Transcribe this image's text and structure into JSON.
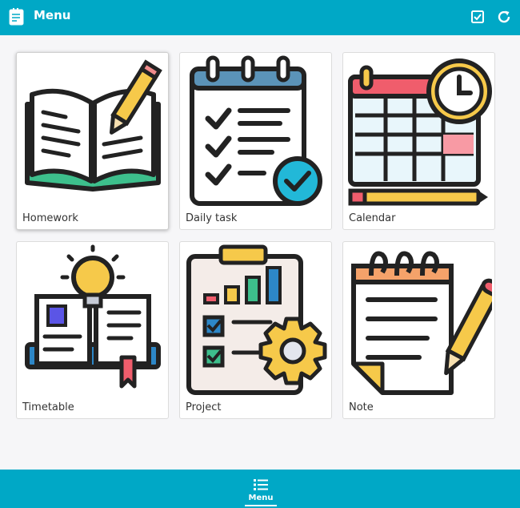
{
  "header": {
    "title": "Menu",
    "icons": {
      "app": "notepad-icon",
      "check": "checkbox-icon",
      "refresh": "refresh-icon"
    }
  },
  "menu": {
    "items": [
      {
        "label": "Homework",
        "icon": "open-book-pencil-icon"
      },
      {
        "label": "Daily task",
        "icon": "checklist-icon"
      },
      {
        "label": "Calendar",
        "icon": "calendar-clock-icon"
      },
      {
        "label": "Timetable",
        "icon": "book-lightbulb-icon"
      },
      {
        "label": "Project",
        "icon": "clipboard-chart-gear-icon"
      },
      {
        "label": "Note",
        "icon": "notepad-pencil-icon"
      }
    ]
  },
  "bottom_nav": {
    "items": [
      {
        "label": "Menu",
        "icon": "list-icon",
        "active": true
      }
    ]
  },
  "colors": {
    "primary": "#00a8c6",
    "background": "#f6f6f8",
    "card": "#ffffff"
  }
}
